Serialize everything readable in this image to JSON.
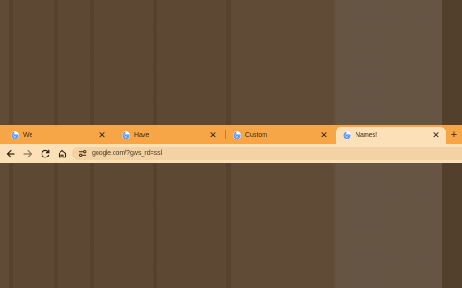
{
  "tabs": [
    {
      "title": "We",
      "active": false
    },
    {
      "title": "Have",
      "active": false
    },
    {
      "title": "Custom",
      "active": false
    },
    {
      "title": "Names!",
      "active": true
    }
  ],
  "new_tab_glyph": "+",
  "close_glyph": "✕",
  "toolbar": {
    "url": "google.com/?gws_rd=ssl"
  },
  "icons": [
    "google-favicon-icon",
    "close-icon",
    "plus-icon",
    "back-arrow-icon",
    "forward-arrow-icon",
    "reload-icon",
    "home-icon",
    "site-info-icon"
  ],
  "colors": {
    "wallpaper": "#5a4530",
    "tabstrip": "#f6a646",
    "active_tab": "#fbe0b8",
    "toolbar": "#fbe0b8",
    "omnibox": "#f3d2a4"
  }
}
